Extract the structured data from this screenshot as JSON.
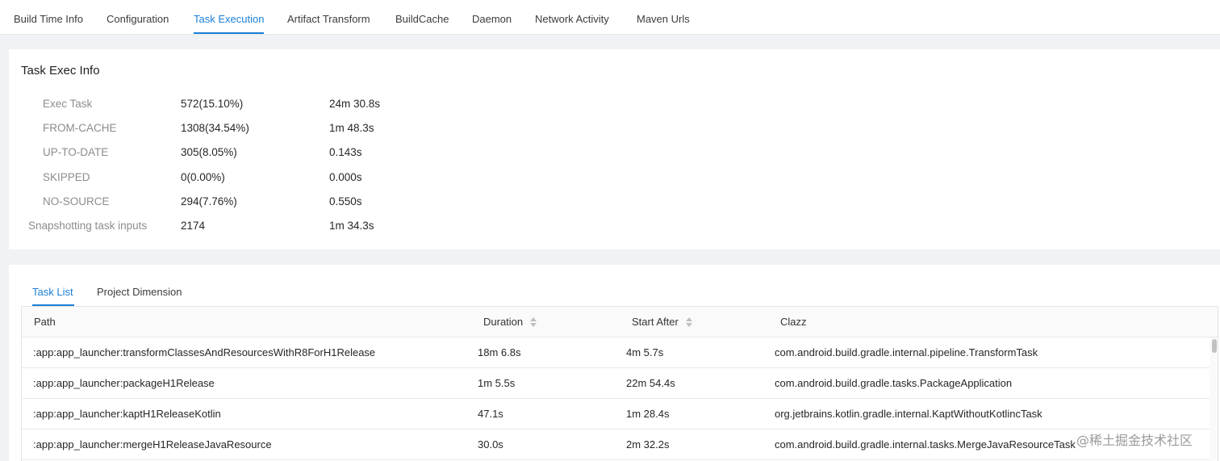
{
  "nav": {
    "tabs": [
      {
        "label": "Build Time Info"
      },
      {
        "label": "Configuration"
      },
      {
        "label": "Task Execution"
      },
      {
        "label": "Artifact Transform"
      },
      {
        "label": "BuildCache"
      },
      {
        "label": "Daemon"
      },
      {
        "label": "Network Activity"
      },
      {
        "label": "Maven Urls"
      }
    ],
    "active_index": 2
  },
  "exec_info": {
    "title": "Task Exec Info",
    "rows": [
      {
        "label": "Exec Task",
        "count": "572(15.10%)",
        "time": "24m 30.8s"
      },
      {
        "label": "FROM-CACHE",
        "count": "1308(34.54%)",
        "time": "1m 48.3s"
      },
      {
        "label": "UP-TO-DATE",
        "count": "305(8.05%)",
        "time": "0.143s"
      },
      {
        "label": "SKIPPED",
        "count": "0(0.00%)",
        "time": "0.000s"
      },
      {
        "label": "NO-SOURCE",
        "count": "294(7.76%)",
        "time": "0.550s"
      },
      {
        "label": "Snapshotting task inputs",
        "count": "2174",
        "time": "1m 34.3s"
      }
    ]
  },
  "task_panel": {
    "tabs": [
      {
        "label": "Task List"
      },
      {
        "label": "Project Dimension"
      }
    ],
    "active_index": 0,
    "columns": {
      "path": "Path",
      "duration": "Duration",
      "start_after": "Start After",
      "clazz": "Clazz"
    },
    "rows": [
      {
        "path": ":app:app_launcher:transformClassesAndResourcesWithR8ForH1Release",
        "duration": "18m 6.8s",
        "start_after": "4m 5.7s",
        "clazz": "com.android.build.gradle.internal.pipeline.TransformTask"
      },
      {
        "path": ":app:app_launcher:packageH1Release",
        "duration": "1m 5.5s",
        "start_after": "22m 54.4s",
        "clazz": "com.android.build.gradle.tasks.PackageApplication"
      },
      {
        "path": ":app:app_launcher:kaptH1ReleaseKotlin",
        "duration": "47.1s",
        "start_after": "1m 28.4s",
        "clazz": "org.jetbrains.kotlin.gradle.internal.KaptWithoutKotlincTask"
      },
      {
        "path": ":app:app_launcher:mergeH1ReleaseJavaResource",
        "duration": "30.0s",
        "start_after": "2m 32.2s",
        "clazz": "com.android.build.gradle.internal.tasks.MergeJavaResourceTask"
      }
    ]
  },
  "watermark": "@稀土掘金技术社区"
}
